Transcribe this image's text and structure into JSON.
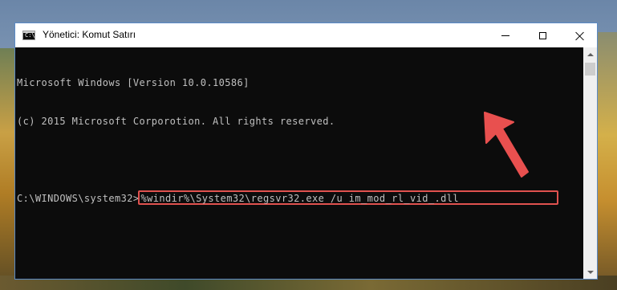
{
  "window": {
    "title": "Yönetici: Komut Satırı",
    "icon_glyph": "C:\\",
    "controls": {
      "minimize": "minimize-icon",
      "maximize": "maximize-icon",
      "close": "close-icon"
    }
  },
  "console": {
    "lines": [
      "Microsoft Windows [Version 10.0.10586]",
      "(c) 2015 Microsoft Corporotion. All rights reserved."
    ],
    "prompt": "C:\\WINDOWS\\system32>",
    "command": "%windir%\\System32\\regsvr32.exe /u im_mod_rl_vid_.dll"
  },
  "colors": {
    "console_bg": "#0c0c0c",
    "console_text": "#c0c0c0",
    "highlight": "#e0524f",
    "window_border": "#5a8ac6"
  }
}
